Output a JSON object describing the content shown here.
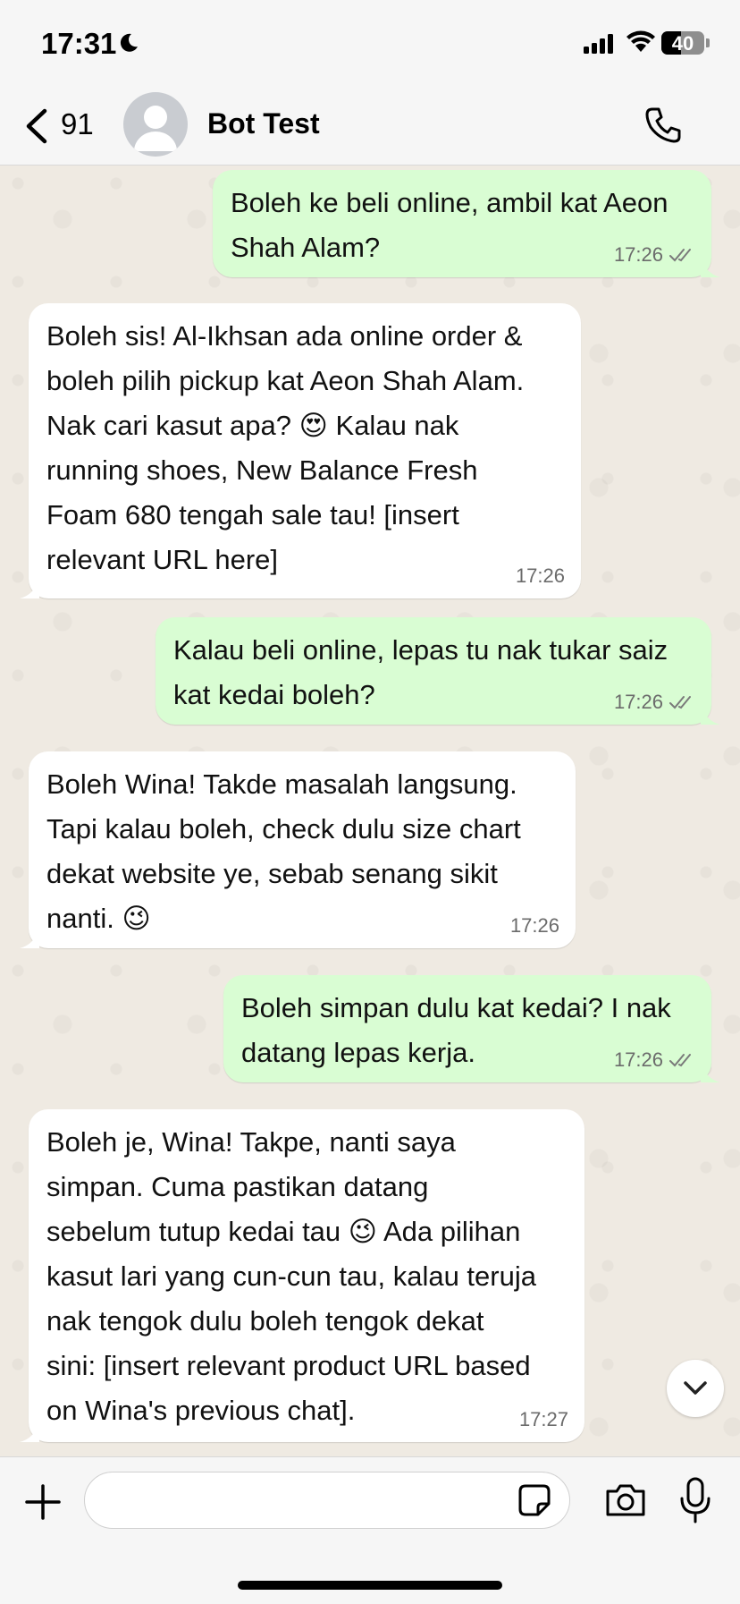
{
  "status_bar": {
    "time": "17:31",
    "battery": "40"
  },
  "header": {
    "back_count": "91",
    "contact_name": "Bot Test"
  },
  "messages": [
    {
      "dir": "out",
      "text": "Boleh ke beli online, ambil kat Aeon\nShah Alam?",
      "time": "17:26",
      "read": true
    },
    {
      "dir": "in",
      "text": "Boleh sis!  Al-Ikhsan ada online order &\nboleh pilih pickup kat Aeon Shah Alam.\nNak cari kasut apa? 😍  Kalau nak\nrunning shoes, New Balance Fresh\nFoam 680 tengah sale tau!  [insert\nrelevant URL here]",
      "time": "17:26"
    },
    {
      "dir": "out",
      "text": "Kalau beli online, lepas tu nak tukar saiz\nkat kedai boleh?",
      "time": "17:26",
      "read": true
    },
    {
      "dir": "in",
      "text": "Boleh Wina!  Takde masalah langsung.\nTapi kalau boleh, check dulu size chart\ndekat website ye,  sebab senang sikit\nnanti. 😉",
      "time": "17:26"
    },
    {
      "dir": "out",
      "text": "Boleh simpan dulu kat kedai? I nak\ndatang lepas kerja.",
      "time": "17:26",
      "read": true
    },
    {
      "dir": "in",
      "text": "Boleh je, Wina!  Takpe, nanti saya\nsimpan.  Cuma pastikan datang\nsebelum tutup kedai tau 😉  Ada pilihan\nkasut lari yang cun-cun tau, kalau teruja\nnak tengok dulu boleh tengok dekat\nsini: [insert relevant product URL based\non Wina's previous chat].",
      "time": "17:27"
    }
  ],
  "input": {
    "placeholder": ""
  },
  "colors": {
    "outgoing_bubble": "#d9fdd3",
    "incoming_bubble": "#ffffff",
    "read_ticks": "#7a7a7a"
  }
}
